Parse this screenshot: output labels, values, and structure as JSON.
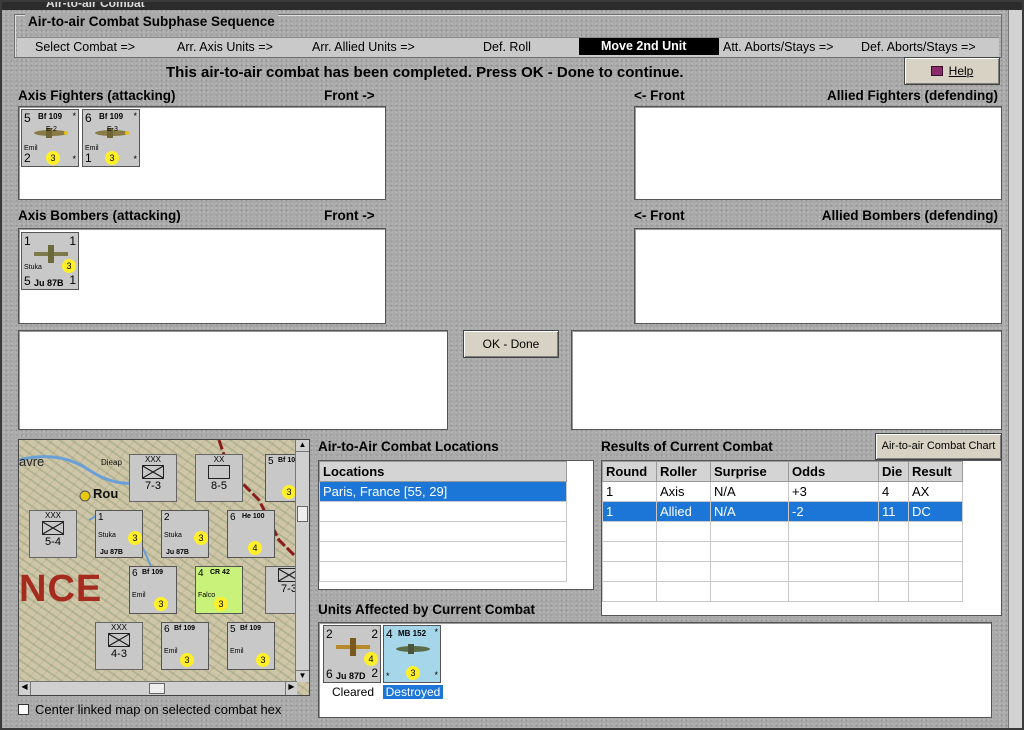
{
  "window": {
    "title": "Air-to-air Combat"
  },
  "sequence": {
    "title": "Air-to-air Combat Subphase Sequence",
    "steps": [
      "Select Combat =>",
      "Arr. Axis Units =>",
      "Arr. Allied Units =>",
      "Def. Roll",
      "Move 2nd Unit",
      "Att. Aborts/Stays =>",
      "Def. Aborts/Stays =>"
    ],
    "active_step": "Move 2nd Unit"
  },
  "status_message": "This air-to-air combat has been completed.  Press OK - Done to continue.",
  "help_button": "Help",
  "sections": {
    "axis_fighters": "Axis Fighters (attacking)",
    "allied_fighters": "Allied Fighters (defending)",
    "axis_bombers": "Axis Bombers (attacking)",
    "allied_bombers": "Allied Bombers (defending)",
    "front_right": "Front ->",
    "front_left": "<- Front"
  },
  "ok_button": "OK - Done",
  "axis_fighter_counters": [
    {
      "tl": "5",
      "name": "Bf 109",
      "sub": "E-2",
      "label": "Emil",
      "bl": "2",
      "factor": "3"
    },
    {
      "tl": "6",
      "name": "Bf 109",
      "sub": "E-3",
      "label": "Emil",
      "bl": "1",
      "factor": "3"
    }
  ],
  "axis_bomber_counters": [
    {
      "tl": "1",
      "tr": "1",
      "label": "Stuka",
      "bl": "5",
      "bottom": "Ju 87B",
      "br": "1",
      "factor": "3"
    }
  ],
  "combat_locations": {
    "title": "Air-to-Air Combat Locations",
    "header": "Locations",
    "rows": [
      "Paris, France [55, 29]"
    ]
  },
  "results": {
    "title": "Results of Current Combat",
    "chart_button": "Air-to-air Combat Chart",
    "columns": [
      "Round",
      "Roller",
      "Surprise",
      "Odds",
      "Die",
      "Result"
    ],
    "rows": [
      [
        "1",
        "Axis",
        "N/A",
        "+3",
        "4",
        "AX"
      ],
      [
        "1",
        "Allied",
        "N/A",
        "-2",
        "11",
        "DC"
      ]
    ],
    "selected_row": 1
  },
  "units_affected": {
    "title": "Units Affected by Current Combat",
    "units": [
      {
        "tl": "2",
        "tr": "2",
        "bl": "6",
        "bottom": "Ju 87D",
        "br": "2",
        "factor": "4",
        "status": "Cleared"
      },
      {
        "tl": "4",
        "name": "MB 152",
        "factor": "3",
        "status": "Destroyed"
      }
    ]
  },
  "map": {
    "labels": {
      "city1": "avre",
      "city2": "Rou",
      "city3": "Dieap",
      "country": "NCE"
    },
    "hexes": [
      {
        "top": "XXX",
        "mid": "7-3"
      },
      {
        "top": "XX",
        "mid": "8-5"
      },
      {
        "top": "XXX",
        "mid": "5-4"
      },
      {
        "top": "XXX",
        "mid": "4-3"
      },
      {
        "top": "",
        "mid": "7-3"
      }
    ],
    "aircraft": [
      {
        "tl": "1",
        "name": "Stuka",
        "bottom": "Ju 87B",
        "factor": "3",
        "stack": "5"
      },
      {
        "tl": "2",
        "name": "Stuka",
        "bottom": "Ju 87B",
        "factor": "3",
        "stack": "4"
      },
      {
        "tl": "6",
        "name": "He 100",
        "factor": "4",
        "stack": "4"
      },
      {
        "tl": "6",
        "name": "Bf 109",
        "bottom": "Emil",
        "factor": "3",
        "stack": "9"
      },
      {
        "tl": "4",
        "name": "CR 42",
        "bottom": "Falco",
        "factor": "3",
        "stack": "4"
      },
      {
        "tl": "6",
        "name": "Bf 109",
        "bottom": "Emil",
        "factor": "3",
        "stack": "3"
      },
      {
        "tl": "5",
        "name": "Bf 109",
        "bottom": "Emil",
        "factor": "3",
        "stack": "2"
      },
      {
        "tl": "5",
        "name": "Bf 109",
        "factor": "3",
        "stack": "2"
      }
    ]
  },
  "center_map_checkbox": {
    "label": "Center linked map on selected combat hex",
    "checked": false
  },
  "colors": {
    "selection": "#1c76d8",
    "chip": "#ffef2a",
    "active_step_bg": "#000000"
  }
}
